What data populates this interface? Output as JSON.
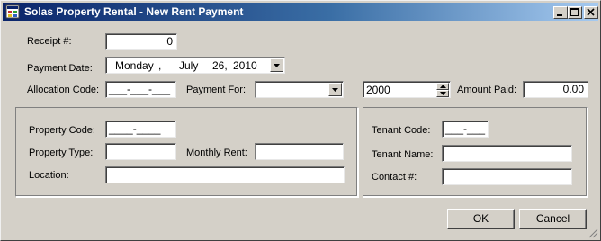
{
  "window": {
    "title": "Solas Property Rental - New Rent Payment"
  },
  "form": {
    "receipt_label": "Receipt #:",
    "receipt_value": "0",
    "payment_date_label": "Payment Date:",
    "payment_date": {
      "day_of_week": "Monday",
      "sep": ",",
      "month": "July",
      "day": "26,",
      "year": "2010"
    },
    "allocation_code_label": "Allocation Code:",
    "allocation_code_mask": "___-___-___",
    "payment_for_label": "Payment For:",
    "payment_for_value": "",
    "year_value": "2000",
    "amount_paid_label": "Amount Paid:",
    "amount_paid_value": "0.00"
  },
  "property": {
    "code_label": "Property Code:",
    "code_mask": "____-____",
    "type_label": "Property Type:",
    "type_value": "",
    "monthly_rent_label": "Monthly Rent:",
    "monthly_rent_value": "",
    "location_label": "Location:",
    "location_value": ""
  },
  "tenant": {
    "code_label": "Tenant Code:",
    "code_mask": "___-___",
    "name_label": "Tenant Name:",
    "name_value": "",
    "contact_label": "Contact #:",
    "contact_value": ""
  },
  "buttons": {
    "ok": "OK",
    "cancel": "Cancel"
  },
  "icons": {
    "app": "app-window-icon",
    "minimize": "minimize-icon",
    "maximize": "maximize-icon",
    "close": "close-icon",
    "dropdown": "chevron-down-icon"
  }
}
